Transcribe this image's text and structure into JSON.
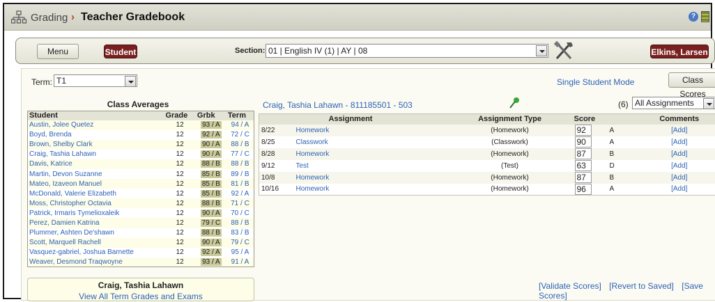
{
  "title": {
    "breadcrumb": "Grading",
    "separator": "›",
    "page": "Teacher Gradebook",
    "icons": [
      "tree-icon",
      "help-icon",
      "grid-icon"
    ]
  },
  "toolbar": {
    "menu_label": "Menu",
    "student_label": "Student",
    "section_label": "Section:",
    "section_value": "01 | English IV (1) | AY | 08",
    "teacher_label": "Elkins, Larsen"
  },
  "controls": {
    "term_label": "Term:",
    "term_value": "T1",
    "single_mode": "Single Student Mode",
    "class_scores": "Class Scores"
  },
  "class_averages": {
    "title": "Class Averages",
    "headers": [
      "Student",
      "Grade",
      "Grbk",
      "Term"
    ],
    "rows": [
      [
        "Austin, Jolee Quetez",
        "12",
        "93 / A",
        "94 / A"
      ],
      [
        "Boyd, Brenda",
        "12",
        "92 / A",
        "72 / C"
      ],
      [
        "Brown, Shelby Clark",
        "12",
        "90 / A",
        "88 / B"
      ],
      [
        "Craig, Tashia Lahawn",
        "12",
        "90 / A",
        "77 / C"
      ],
      [
        "Davis, Katrice",
        "12",
        "88 / B",
        "88 / B"
      ],
      [
        "Martin, Devon Suzanne",
        "12",
        "85 / B",
        "89 / B"
      ],
      [
        "Mateo, Izaveon Manuel",
        "12",
        "85 / B",
        "81 / B"
      ],
      [
        "McDonald, Valerie Elizabeth",
        "12",
        "85 / B",
        "92 / A"
      ],
      [
        "Moss, Christopher Octavia",
        "12",
        "88 / B",
        "71 / C"
      ],
      [
        "Patrick, Irmaris Tymelioxaleik",
        "12",
        "90 / A",
        "70 / C"
      ],
      [
        "Perez, Damien Katrina",
        "12",
        "79 / C",
        "88 / B"
      ],
      [
        "Plummer, Ashten De'shawn",
        "12",
        "88 / B",
        "83 / B"
      ],
      [
        "Scott, Marquell Rachell",
        "12",
        "90 / A",
        "79 / C"
      ],
      [
        "Vasquez-gabriel, Joshua Barnette",
        "12",
        "92 / A",
        "95 / A"
      ],
      [
        "Weaver, Desmond Traqwoyne",
        "12",
        "93 / A",
        "91 / A"
      ]
    ]
  },
  "selected_student": {
    "header": "Craig, Tashia Lahawn - 811185501 - 503",
    "assignment_count": "(6)",
    "assignment_filter": "All Assignments",
    "box_name": "Craig, Tashia Lahawn",
    "box_link": "View All Term Grades and Exams"
  },
  "assignments": {
    "headers": [
      "",
      "Assignment",
      "Assignment Type",
      "Score",
      "",
      "Comments"
    ],
    "rows": [
      {
        "date": "8/22",
        "name": "Homework",
        "type": "(Homework)",
        "score": "92",
        "letter": "A",
        "comment": "[Add]"
      },
      {
        "date": "8/25",
        "name": "Classwork",
        "type": "(Classwork)",
        "score": "90",
        "letter": "A",
        "comment": "[Add]"
      },
      {
        "date": "8/28",
        "name": "Homework",
        "type": "(Homework)",
        "score": "87",
        "letter": "B",
        "comment": "[Add]"
      },
      {
        "date": "9/12",
        "name": "Test",
        "type": "(Test)",
        "score": "63",
        "letter": "D",
        "comment": "[Add]"
      },
      {
        "date": "10/8",
        "name": "Homework",
        "type": "(Homework)",
        "score": "87",
        "letter": "B",
        "comment": "[Add]"
      },
      {
        "date": "10/16",
        "name": "Homework",
        "type": "(Homework)",
        "score": "96",
        "letter": "A",
        "comment": "[Add]"
      }
    ]
  },
  "actions": {
    "validate": "[Validate Scores]",
    "revert": "[Revert to Saved]",
    "save": "[Save Scores]"
  },
  "colors": {
    "accent_button": "#7a1f1f",
    "link": "#2f62b4",
    "grbk_highlight": "#c9c99a"
  }
}
